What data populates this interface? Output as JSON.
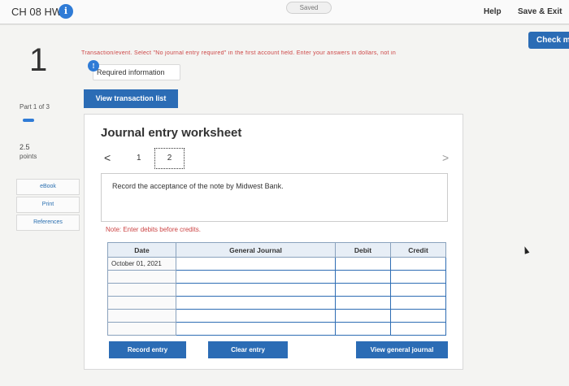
{
  "topbar": {
    "assignment_title": "CH 08 HW",
    "info_icon": "i",
    "saved_status": "Saved",
    "help_label": "Help",
    "save_exit_label": "Save & Exit"
  },
  "sidebar": {
    "question_number": "1",
    "part_label": "Part 1 of 3",
    "points_value": "2.5",
    "points_label": "points",
    "links": [
      {
        "label": "eBook"
      },
      {
        "label": "Print"
      },
      {
        "label": "References"
      }
    ]
  },
  "main": {
    "check_button": "Check my work",
    "instructions": "Transaction/event. Select \"No journal entry required\" in the first account field. Enter your answers in dollars, not in",
    "required_icon": "!",
    "required_label": "Required information",
    "view_transactions_label": "View transaction list",
    "worksheet": {
      "title": "Journal entry worksheet",
      "prev_icon": "<",
      "next_icon": ">",
      "pages": [
        "1",
        "2"
      ],
      "transaction_description": "Record the acceptance of the note by Midwest Bank.",
      "note": "Note: Enter debits before credits.",
      "columns": [
        "Date",
        "General Journal",
        "Debit",
        "Credit"
      ],
      "rows": [
        {
          "date": "October 01, 2021",
          "account": "",
          "debit": "",
          "credit": ""
        },
        {
          "date": "",
          "account": "",
          "debit": "",
          "credit": ""
        },
        {
          "date": "",
          "account": "",
          "debit": "",
          "credit": ""
        },
        {
          "date": "",
          "account": "",
          "debit": "",
          "credit": ""
        },
        {
          "date": "",
          "account": "",
          "debit": "",
          "credit": ""
        },
        {
          "date": "",
          "account": "",
          "debit": "",
          "credit": ""
        }
      ],
      "buttons": {
        "record": "Record entry",
        "clear": "Clear entry",
        "view_journal": "View general journal"
      }
    }
  }
}
